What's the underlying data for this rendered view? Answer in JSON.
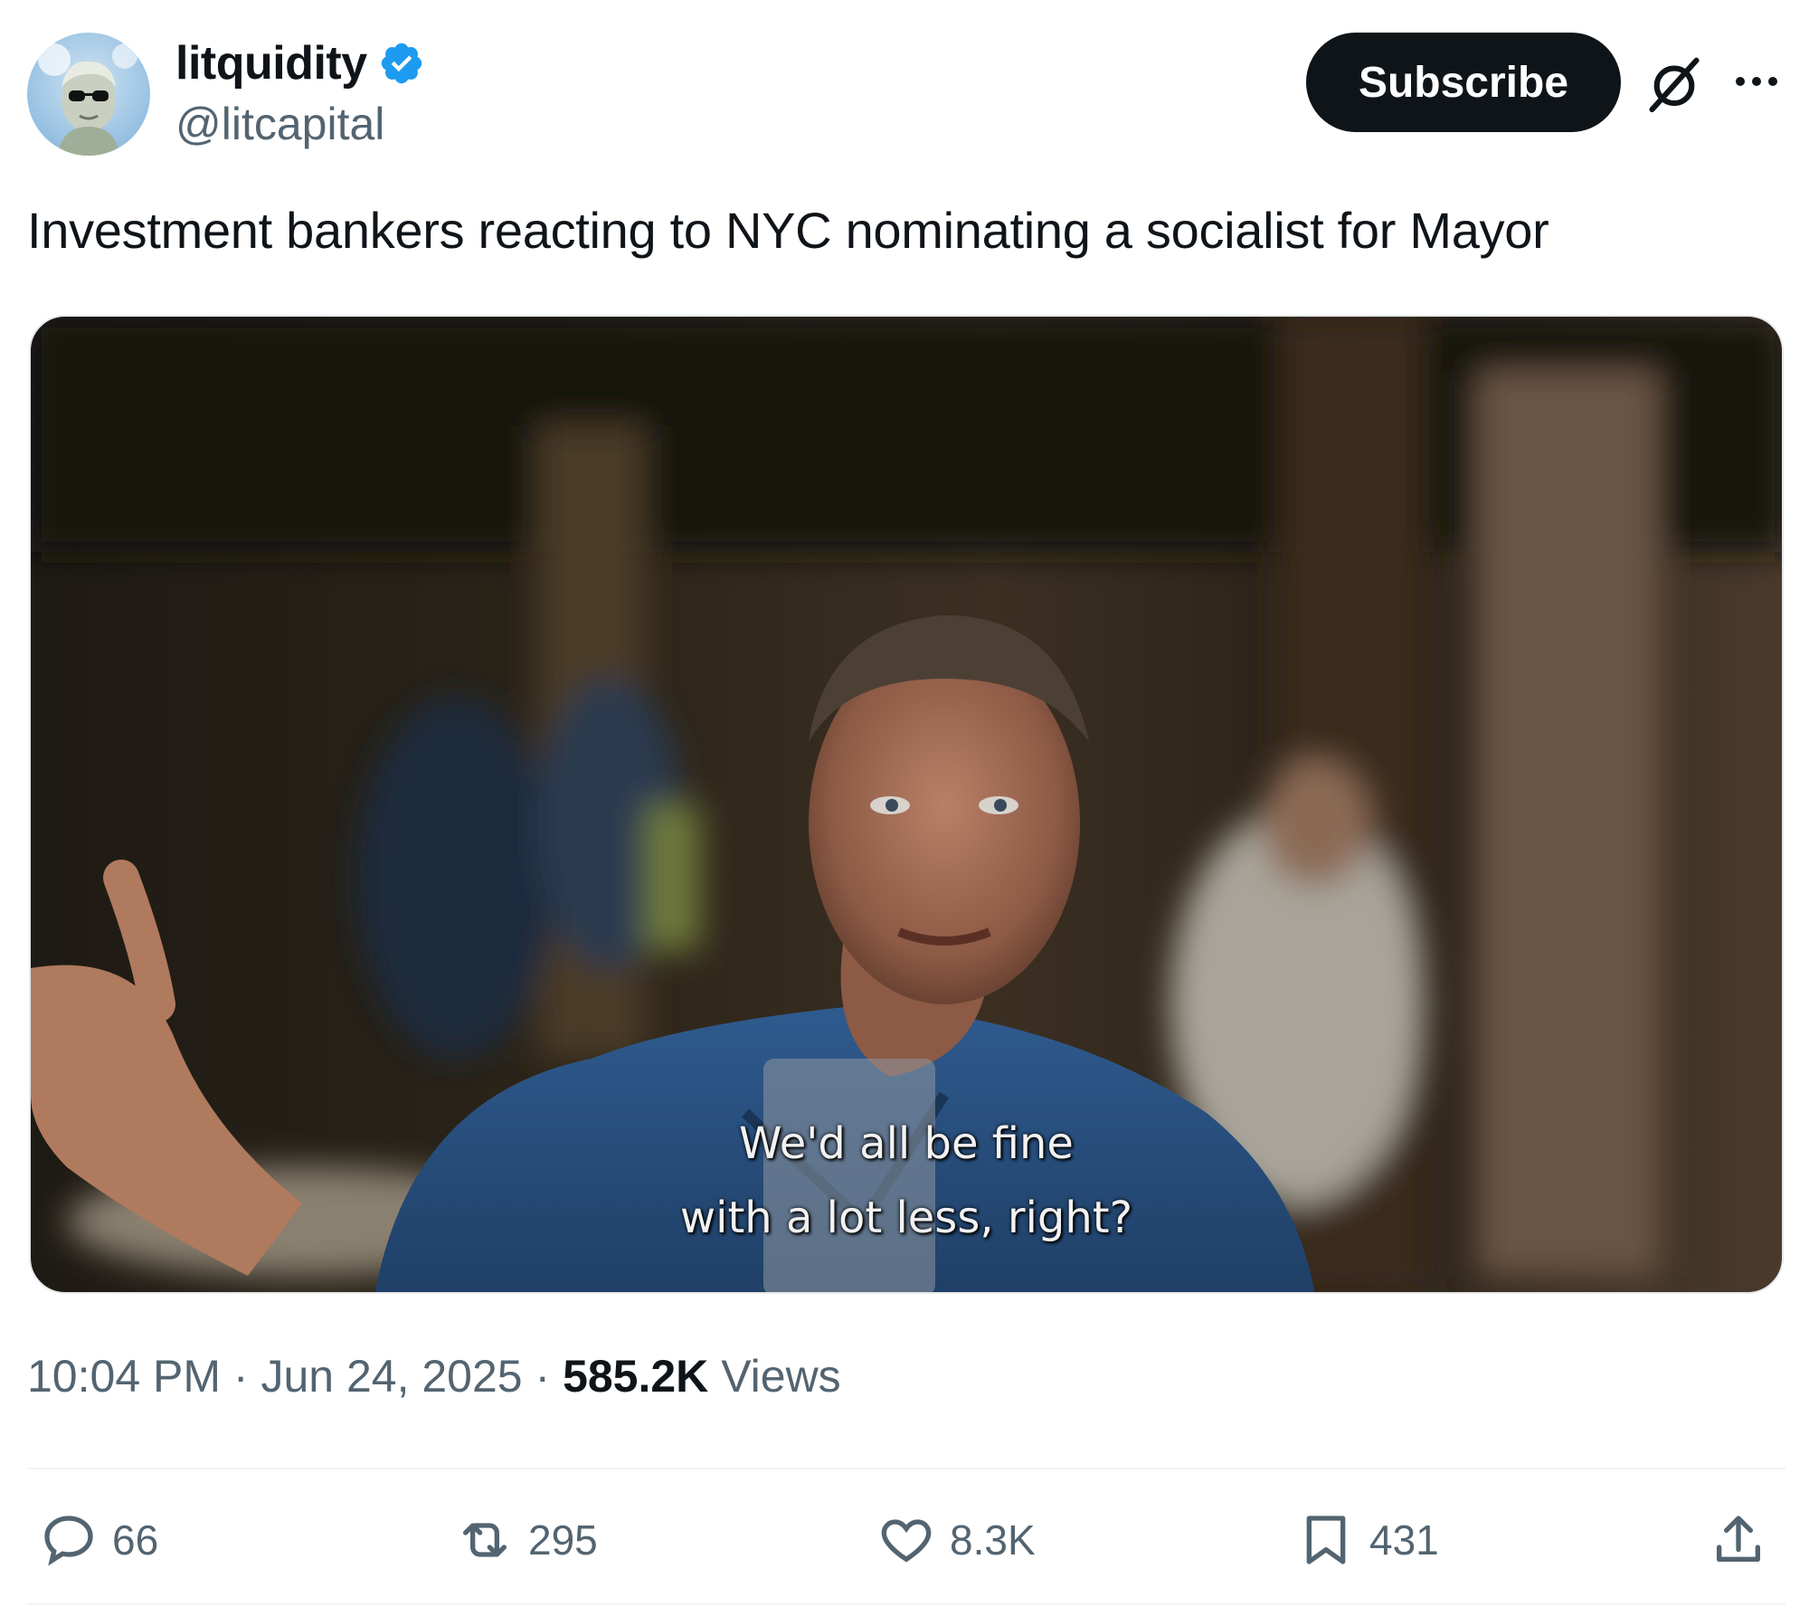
{
  "author": {
    "display_name": "litquidity",
    "handle": "@litcapital",
    "verified": true
  },
  "header": {
    "subscribe_label": "Subscribe"
  },
  "tweet": {
    "text": "Investment bankers reacting to NYC nominating a socialist for Mayor",
    "media": {
      "subtitle_line1": "We'd all be fine",
      "subtitle_line2": "with a lot less, right?"
    },
    "time": "10:04 PM",
    "date": "Jun 24, 2025",
    "views_count": "585.2K",
    "views_label": "Views"
  },
  "actions": {
    "replies": "66",
    "reposts": "295",
    "likes": "8.3K",
    "bookmarks": "431"
  },
  "colors": {
    "text_primary": "#0f1419",
    "text_secondary": "#536471",
    "verified_blue": "#1d9bf0",
    "button_dark": "#0f1419",
    "divider": "#eff3f4"
  },
  "icons": [
    "verified-badge-icon",
    "grok-icon",
    "more-icon",
    "reply-icon",
    "repost-icon",
    "like-icon",
    "bookmark-icon",
    "share-icon"
  ]
}
